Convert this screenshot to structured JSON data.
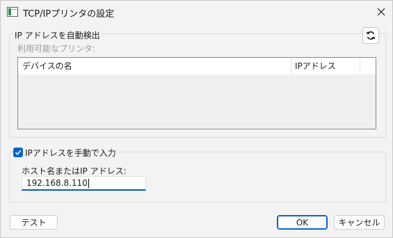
{
  "window": {
    "title": "TCP/IPプリンタの設定",
    "app_icon": "printer-window-icon",
    "close_icon": "close-icon"
  },
  "auto_detect": {
    "group_label": "IP アドレスを自動検出",
    "available_label": "利用可能なプリンタ:",
    "refresh_icon": "refresh-icon",
    "table": {
      "columns": [
        "デバイスの名",
        "IPアドレス"
      ],
      "rows": []
    }
  },
  "manual": {
    "checkbox_label": "IPアドレスを手動で入力",
    "checked": true,
    "field_label": "ホスト名またはIP アドレス:",
    "value": "192.168.8.110"
  },
  "buttons": {
    "test": "テスト",
    "ok": "OK",
    "cancel": "キャンセル"
  },
  "colors": {
    "accent": "#0a64c8",
    "background": "#f3f3f3"
  }
}
